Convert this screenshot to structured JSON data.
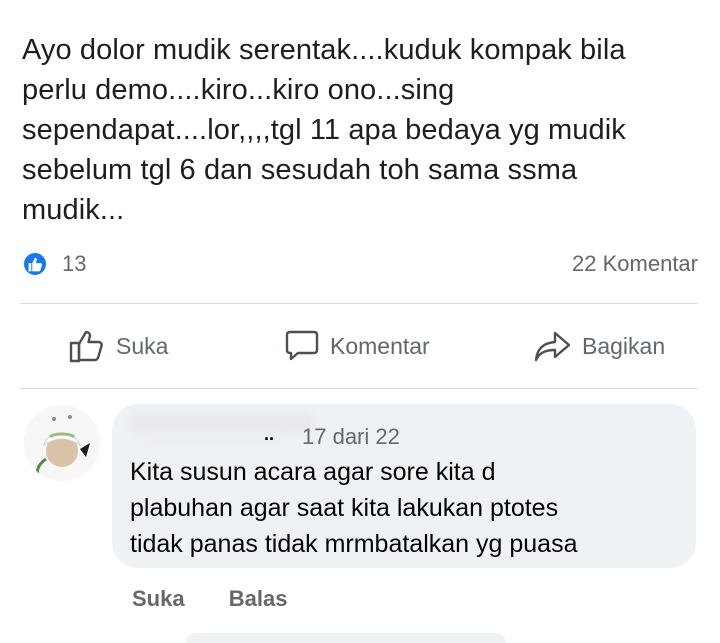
{
  "post": {
    "text_lines": [
      "Ayo dolor mudik serentak....kuduk kompak bila",
      "perlu demo....kiro...kiro ono...sing",
      "sependapat....lor,,,,tgl 11 apa bedaya yg mudik",
      "sebelum tgl 6 dan sesudah toh sama ssma",
      "mudik..."
    ]
  },
  "reactions": {
    "like_count": "13",
    "comment_count": "22 Komentar",
    "badge_color": "#1877f2",
    "badge_icon": "thumbs-up-icon"
  },
  "actions": {
    "like_label": "Suka",
    "comment_label": "Komentar",
    "share_label": "Bagikan"
  },
  "comment": {
    "meta": "17 dari 22",
    "text_lines": [
      "Kita susun acara agar sore kita d",
      "plabuhan agar saat kita lakukan ptotes",
      "tidak panas tidak mrmbatalkan yg puasa"
    ],
    "like_label": "Suka",
    "reply_label": "Balas"
  }
}
